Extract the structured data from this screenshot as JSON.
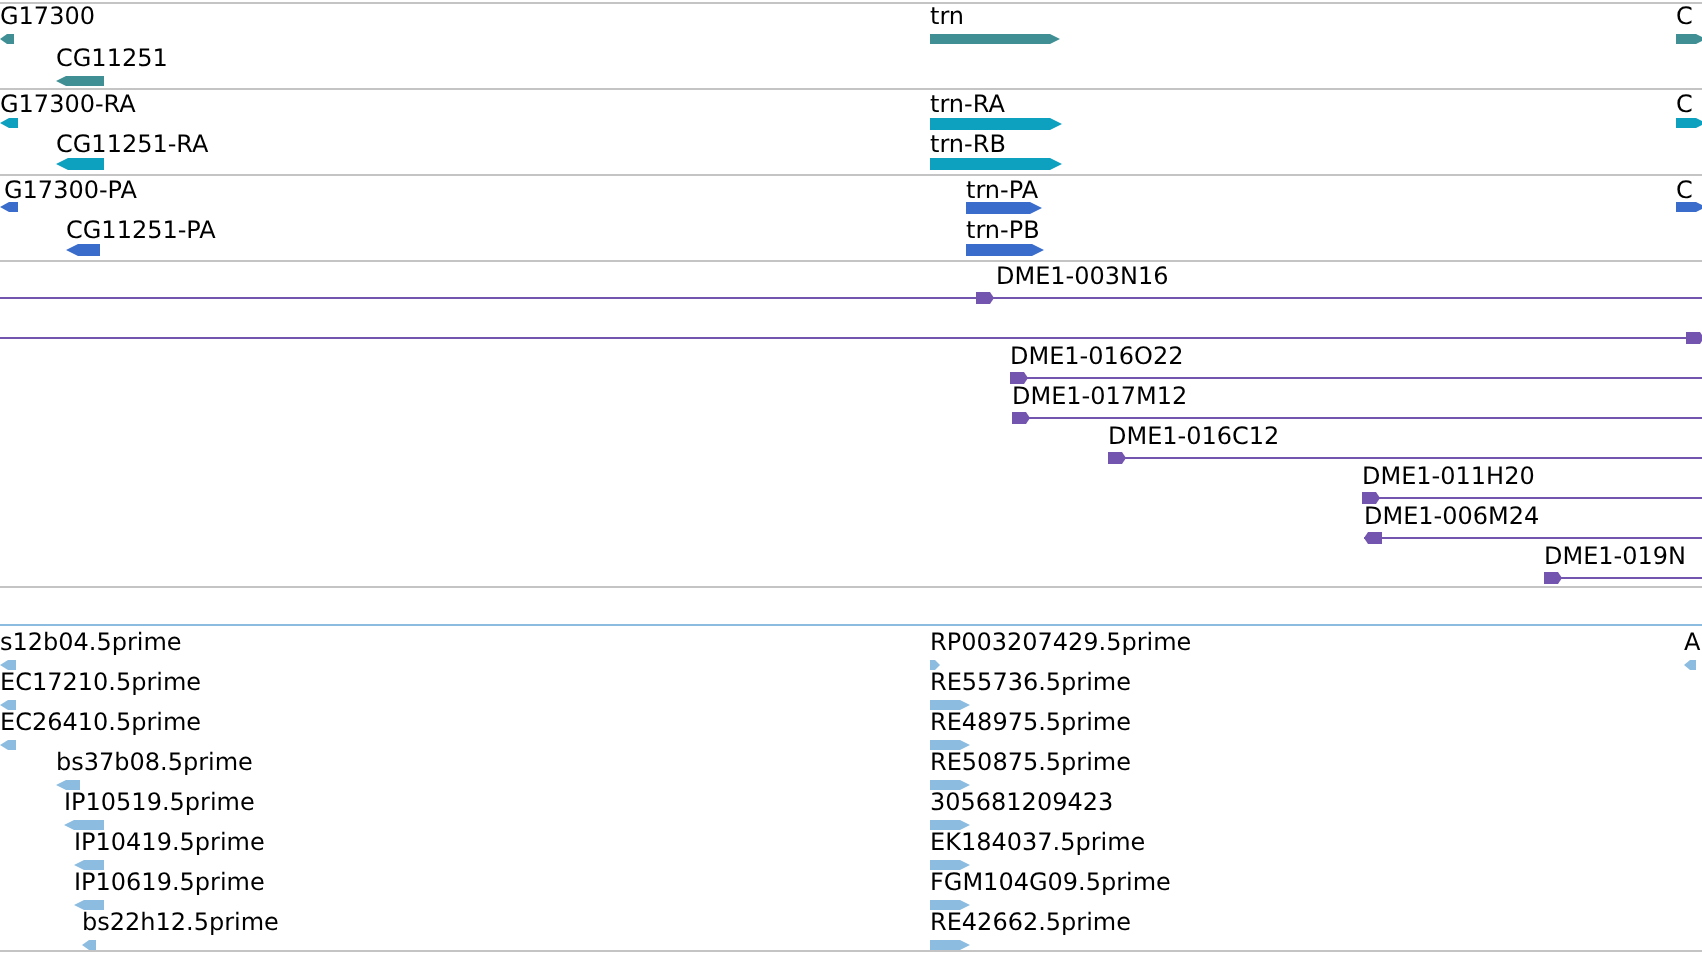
{
  "tracks": [
    {
      "kind": "gene",
      "color": "#3f8f94",
      "features": [
        {
          "label": "G17300",
          "reverse": true
        },
        {
          "label": "CG11251",
          "reverse": true
        },
        {
          "label": "trn",
          "reverse": false
        },
        {
          "label": "C",
          "reverse": false
        }
      ]
    },
    {
      "kind": "transcript",
      "color": "#0ea0bf",
      "features": [
        {
          "label": "G17300-RA",
          "reverse": true
        },
        {
          "label": "CG11251-RA",
          "reverse": true
        },
        {
          "label": "trn-RA",
          "reverse": false
        },
        {
          "label": "trn-RB",
          "reverse": false
        },
        {
          "label": "C",
          "reverse": false
        }
      ]
    },
    {
      "kind": "protein",
      "color": "#3a6ccc",
      "features": [
        {
          "label": "G17300-PA",
          "reverse": true
        },
        {
          "label": "CG11251-PA",
          "reverse": true
        },
        {
          "label": "trn-PA",
          "reverse": false
        },
        {
          "label": "trn-PB",
          "reverse": false
        },
        {
          "label": "C",
          "reverse": false
        }
      ]
    },
    {
      "kind": "clone",
      "color": "#7355b0",
      "features": [
        {
          "label": "DME1-003N16",
          "reverse": false
        },
        {
          "reverse": false
        },
        {
          "label": "DME1-016O22",
          "reverse": false
        },
        {
          "label": "DME1-017M12",
          "reverse": false
        },
        {
          "label": "DME1-016C12",
          "reverse": false
        },
        {
          "label": "DME1-011H20",
          "reverse": false
        },
        {
          "label": "DME1-006M24",
          "reverse": true
        },
        {
          "label": "DME1-019N",
          "reverse": false
        }
      ]
    },
    {
      "kind": "est",
      "color": "#8cbde0",
      "features": [
        {
          "label": "s12b04.5prime",
          "reverse": true
        },
        {
          "label": "EC17210.5prime",
          "reverse": true
        },
        {
          "label": "EC26410.5prime",
          "reverse": true
        },
        {
          "label": "bs37b08.5prime",
          "reverse": true
        },
        {
          "label": "IP10519.5prime",
          "reverse": true
        },
        {
          "label": "IP10419.5prime",
          "reverse": true
        },
        {
          "label": "IP10619.5prime",
          "reverse": true
        },
        {
          "label": "bs22h12.5prime",
          "reverse": true
        },
        {
          "label": "RP003207429.5prime",
          "reverse": false
        },
        {
          "label": "RE55736.5prime",
          "reverse": false
        },
        {
          "label": "RE48975.5prime",
          "reverse": false
        },
        {
          "label": "RE50875.5prime",
          "reverse": false
        },
        {
          "label": "305681209423",
          "reverse": false
        },
        {
          "label": "EK184037.5prime",
          "reverse": false
        },
        {
          "label": "FGM104G09.5prime",
          "reverse": false
        },
        {
          "label": "RE42662.5prime",
          "reverse": false
        },
        {
          "label": "A",
          "reverse": true
        }
      ]
    }
  ]
}
